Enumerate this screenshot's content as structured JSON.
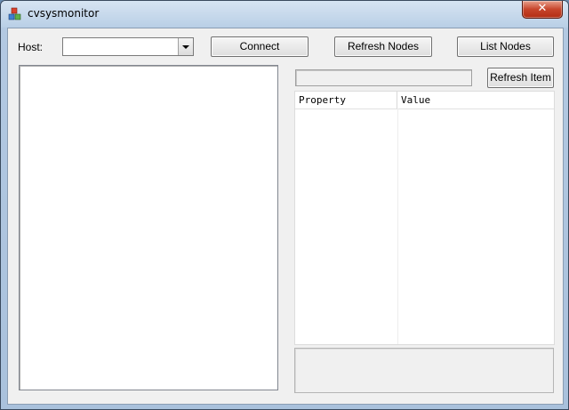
{
  "window": {
    "title": "cvsysmonitor",
    "close_glyph": "✕",
    "icon": "app-cubes-icon"
  },
  "toolbar": {
    "host_label": "Host:",
    "host_value": "",
    "connect_label": "Connect",
    "refresh_nodes_label": "Refresh Nodes",
    "list_nodes_label": "List Nodes"
  },
  "details": {
    "item_value": "",
    "refresh_item_label": "Refresh Item",
    "columns": [
      "Property",
      "Value"
    ],
    "rows": []
  },
  "colors": {
    "close_button": "#c7452b",
    "client_background": "#f0f0f0"
  }
}
